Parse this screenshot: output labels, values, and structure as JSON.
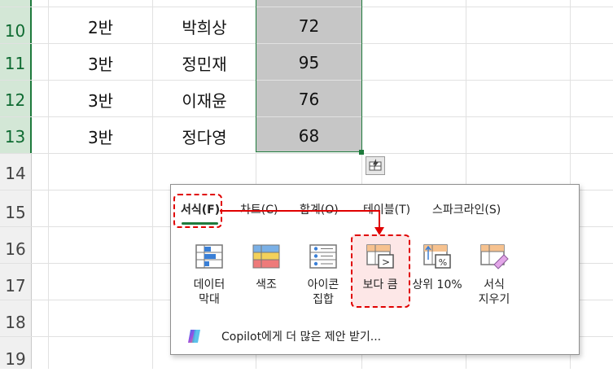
{
  "sheet": {
    "rows": [
      {
        "num": "10",
        "class": "2반",
        "name": "박희상",
        "score": "72"
      },
      {
        "num": "11",
        "class": "3반",
        "name": "정민재",
        "score": "95"
      },
      {
        "num": "12",
        "class": "3반",
        "name": "이재윤",
        "score": "76"
      },
      {
        "num": "13",
        "class": "3반",
        "name": "정다영",
        "score": "68"
      }
    ],
    "empty_rows": [
      "14",
      "15",
      "16",
      "17",
      "18",
      "19"
    ]
  },
  "quick_analysis": {
    "tabs": [
      {
        "label": "서식(F)"
      },
      {
        "label": "차트(C)"
      },
      {
        "label": "합계(O)"
      },
      {
        "label": "테이블(T)"
      },
      {
        "label": "스파크라인(S)"
      }
    ],
    "tiles": [
      {
        "label": "데이터\n막대",
        "icon": "data-bars-icon"
      },
      {
        "label": "색조",
        "icon": "color-scale-icon"
      },
      {
        "label": "아이콘\n집합",
        "icon": "icon-set-icon"
      },
      {
        "label": "보다 큼",
        "icon": "greater-than-icon"
      },
      {
        "label": "상위 10%",
        "icon": "top-10-percent-icon"
      },
      {
        "label": "서식\n지우기",
        "icon": "clear-format-icon"
      }
    ],
    "copilot_label": "Copilot에게 더 많은 제안 받기..."
  },
  "colors": {
    "accent": "#1e7a3c",
    "annotation": "#e00000",
    "selection": "#c6c6c6"
  }
}
